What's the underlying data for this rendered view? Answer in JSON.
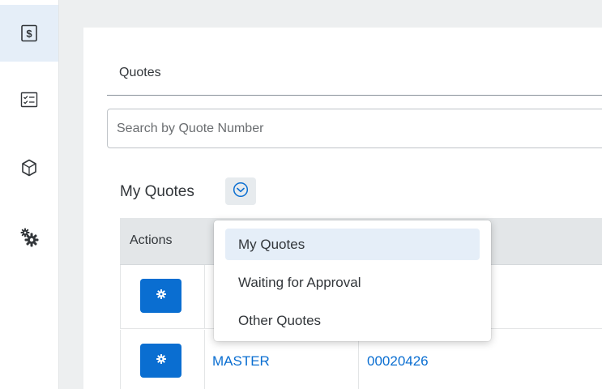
{
  "rail": {
    "items": [
      {
        "icon": "dollar-icon",
        "active": true
      },
      {
        "icon": "checklist-icon",
        "active": false
      },
      {
        "icon": "cube-icon",
        "active": false
      },
      {
        "icon": "gears-icon",
        "active": false
      }
    ]
  },
  "page": {
    "title": "Quotes"
  },
  "search": {
    "placeholder": "Search by Quote Number",
    "value": ""
  },
  "filter": {
    "selected_label": "My Quotes",
    "options": [
      "My Quotes",
      "Waiting for Approval",
      "Other Quotes"
    ]
  },
  "table": {
    "headers": [
      "Actions"
    ],
    "rows": [
      {
        "col2": "",
        "col3": ""
      },
      {
        "col2": "MASTER",
        "col3": "00020426"
      }
    ]
  },
  "colors": {
    "accent": "#0a6ed1",
    "selected_bg": "#e5eef8",
    "header_bg": "#e3e6e8"
  }
}
